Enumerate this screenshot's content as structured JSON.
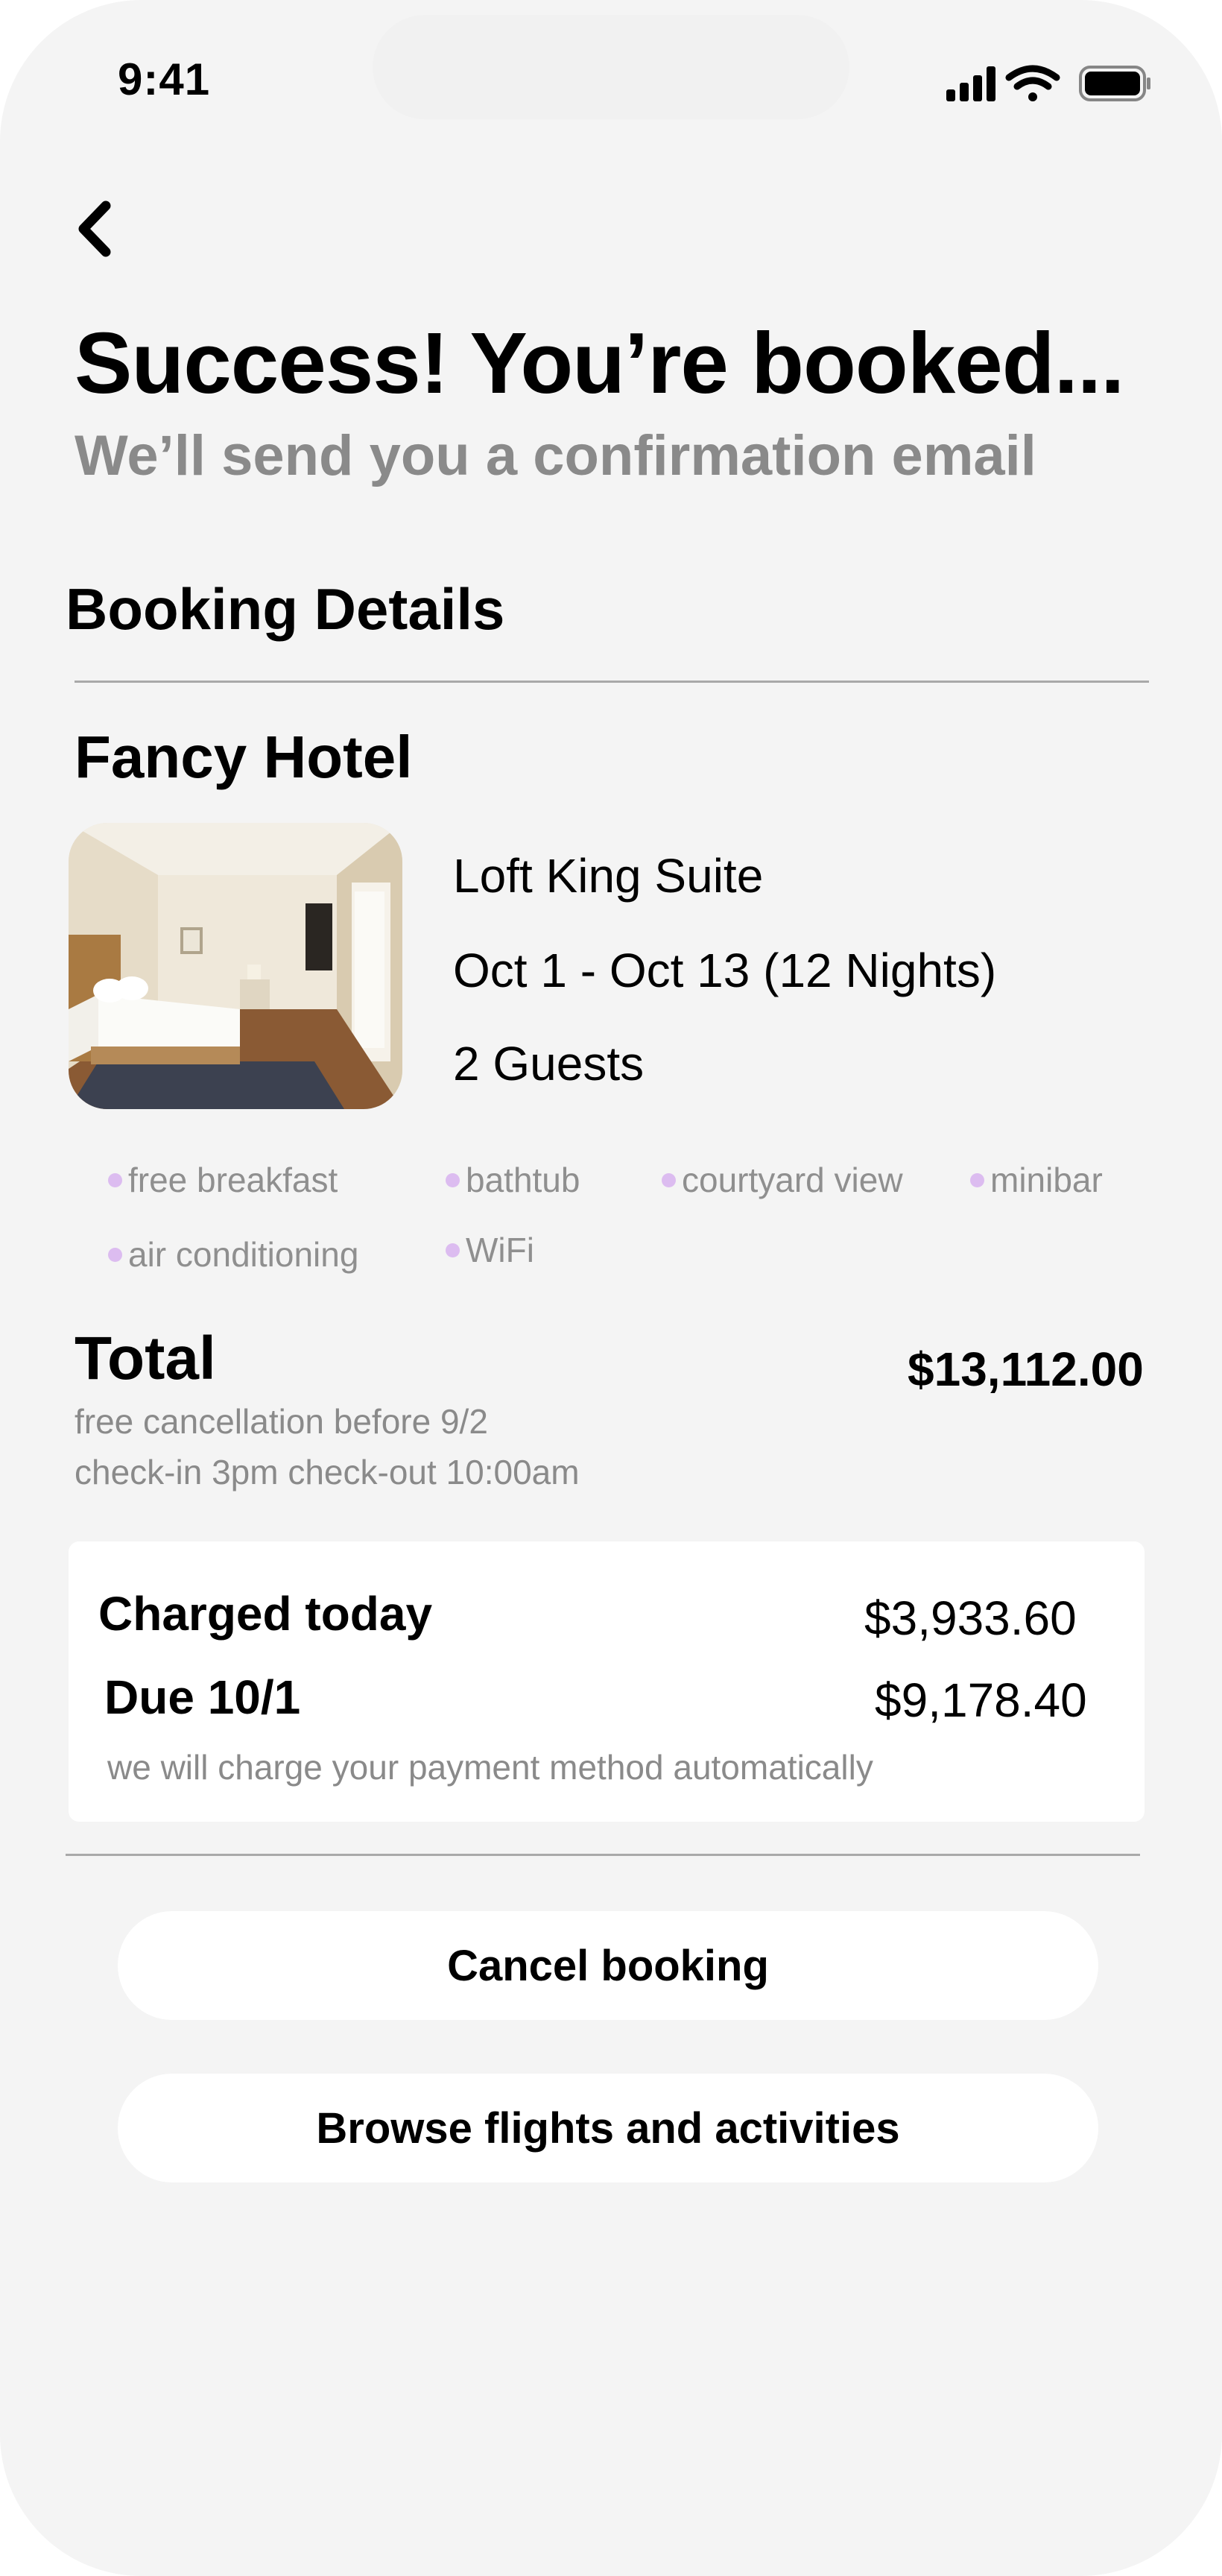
{
  "status_bar": {
    "time": "9:41",
    "icons": [
      "cellular-signal-icon",
      "wifi-icon",
      "battery-icon"
    ]
  },
  "navigation": {
    "back_icon": "chevron-left-icon"
  },
  "header": {
    "title": "Success! You’re booked...",
    "subtitle": "We’ll send you a confirmation email"
  },
  "booking": {
    "section_title": "Booking Details",
    "hotel_name": "Fancy Hotel",
    "room_type": "Loft King Suite",
    "dates": "Oct 1 - Oct 13 (12 Nights)",
    "guests": "2 Guests",
    "amenities": [
      "free breakfast",
      "bathtub",
      "courtyard view",
      "minibar",
      "air conditioning",
      "WiFi"
    ]
  },
  "total": {
    "label": "Total",
    "amount": "$13,112.00",
    "cancellation_policy": "free cancellation before 9/2",
    "check_times": "check-in 3pm check-out 10:00am"
  },
  "payment": {
    "charged_today_label": "Charged today",
    "charged_today_amount": "$3,933.60",
    "due_label": "Due 10/1",
    "due_amount": "$9,178.40",
    "note": "we will charge your payment method automatically"
  },
  "actions": {
    "cancel_label": "Cancel booking",
    "browse_label": "Browse flights and activities"
  },
  "colors": {
    "background": "#f4f4f4",
    "card": "#ffffff",
    "muted_text": "#8a8a8a",
    "amenity_dot": "#dcbcf0",
    "divider": "#a9a9a9"
  }
}
